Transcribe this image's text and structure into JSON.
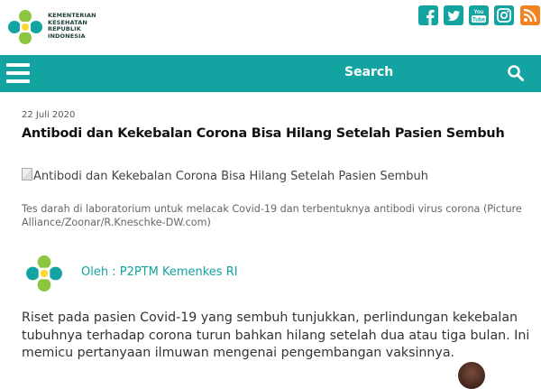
{
  "header": {
    "logo_lines": [
      "KEMENTERIAN",
      "KESEHATAN",
      "REPUBLIK",
      "INDONESIA"
    ],
    "social": [
      "facebook-icon",
      "twitter-icon",
      "youtube-icon",
      "instagram-icon",
      "rss-icon"
    ],
    "youtube_text": "You Tube"
  },
  "nav": {
    "search_label": "Search",
    "accent_color": "#13a3a0"
  },
  "article": {
    "date": "22 Juli 2020",
    "title": "Antibodi dan Kekebalan Corona Bisa Hilang Setelah Pasien Sembuh",
    "image_alt": "Antibodi dan Kekebalan Corona Bisa Hilang Setelah Pasien Sembuh",
    "caption": "Tes darah di laboratorium untuk melacak Covid-19 dan terbentuknya antibodi virus corona (Picture Alliance/Zoonar/R.Kneschke-DW.com)",
    "author": "Oleh : P2PTM Kemenkes RI",
    "body": "Riset pada pasien Covid-19 yang sembuh tunjukkan, perlindungan kekebalan tubuhnya terhadap corona turun bahkan hilang setelah dua atau tiga bulan. Ini memicu pertanyaan ilmuwan mengenai pengembangan vaksinnya."
  }
}
